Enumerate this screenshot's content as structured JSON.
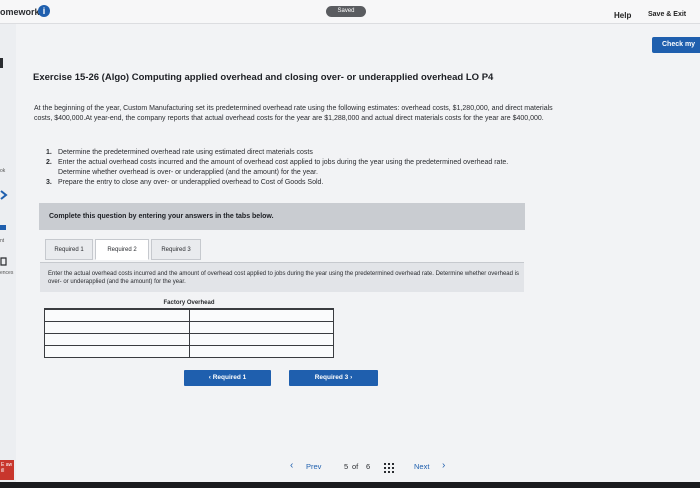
{
  "header": {
    "app_title": "omework",
    "info_icon": "i",
    "saved_label": "Saved",
    "help_label": "Help",
    "save_exit_label": "Save & Exit",
    "check_my_label": "Check my"
  },
  "left_rail": {
    "labels": [
      "ok",
      "nt",
      "ences"
    ],
    "badge": "E aw ill"
  },
  "exercise": {
    "title": "Exercise 15-26 (Algo) Computing applied overhead and closing over- or underapplied overhead LO P4",
    "intro": "At the beginning of the year, Custom Manufacturing set its predetermined overhead rate using the following estimates: overhead costs, $1,280,000, and direct materials costs, $400,000.At year-end, the company reports that actual overhead costs for the year are $1,288,000 and actual direct materials costs for the year are $400,000.",
    "steps": [
      {
        "num": "1.",
        "text": "Determine the predetermined overhead rate using estimated direct materials costs"
      },
      {
        "num": "2.",
        "text": "Enter the actual overhead costs incurred and the amount of overhead cost applied to jobs during the year using the predetermined overhead rate. Determine whether overhead is over- or underapplied (and the amount) for the year."
      },
      {
        "num": "3.",
        "text": "Prepare the entry to close any over- or underapplied overhead to Cost of Goods Sold."
      }
    ],
    "instruction": "Complete this question by entering your answers in the tabs below."
  },
  "tabs": [
    {
      "label": "Required 1",
      "active": false
    },
    {
      "label": "Required 2",
      "active": true
    },
    {
      "label": "Required 3",
      "active": false
    }
  ],
  "tab_note": "Enter the actual overhead costs incurred and the amount of overhead cost applied to jobs during the year using the predetermined overhead rate. Determine whether overhead is over- or underapplied (and the amount) for the year.",
  "ledger": {
    "title": "Factory Overhead",
    "rows": 4
  },
  "nav": {
    "prev_required": "Required 1",
    "next_required": "Required 3",
    "prev_page": "Prev",
    "page_current": "5",
    "page_of": "of",
    "page_total": "6",
    "next_page": "Next"
  },
  "colors": {
    "accent": "#1f5fae",
    "instruction_bar": "#c9ccd1"
  }
}
